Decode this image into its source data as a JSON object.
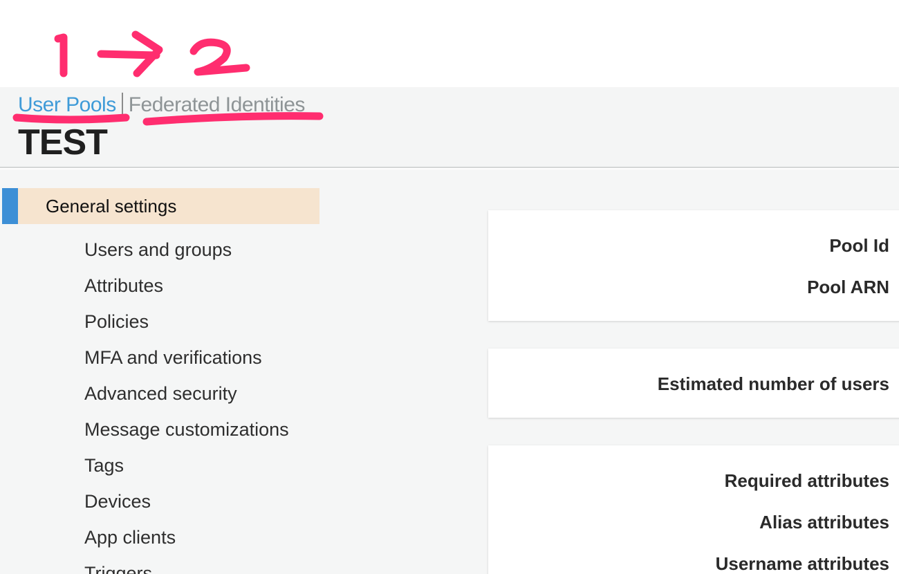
{
  "annotation": {
    "step_1": "1",
    "step_2": "2",
    "color": "#ff2d6f"
  },
  "breadcrumb": {
    "user_pools": "User Pools",
    "federated_identities": "Federated Identities"
  },
  "page_title": "TEST",
  "sidebar": {
    "active_item": "General settings",
    "items": [
      "Users and groups",
      "Attributes",
      "Policies",
      "MFA and verifications",
      "Advanced security",
      "Message customizations",
      "Tags",
      "Devices",
      "App clients",
      "Triggers"
    ]
  },
  "cards": {
    "pool": {
      "pool_id_label": "Pool Id",
      "pool_arn_label": "Pool ARN"
    },
    "users": {
      "estimated_users_label": "Estimated number of users"
    },
    "attributes": {
      "required_label": "Required attributes",
      "alias_label": "Alias attributes",
      "username_label": "Username attributes"
    }
  },
  "colors": {
    "link_blue": "#3f9bd8",
    "active_bg": "#f6e4cf",
    "active_accent": "#3d8fd6"
  }
}
